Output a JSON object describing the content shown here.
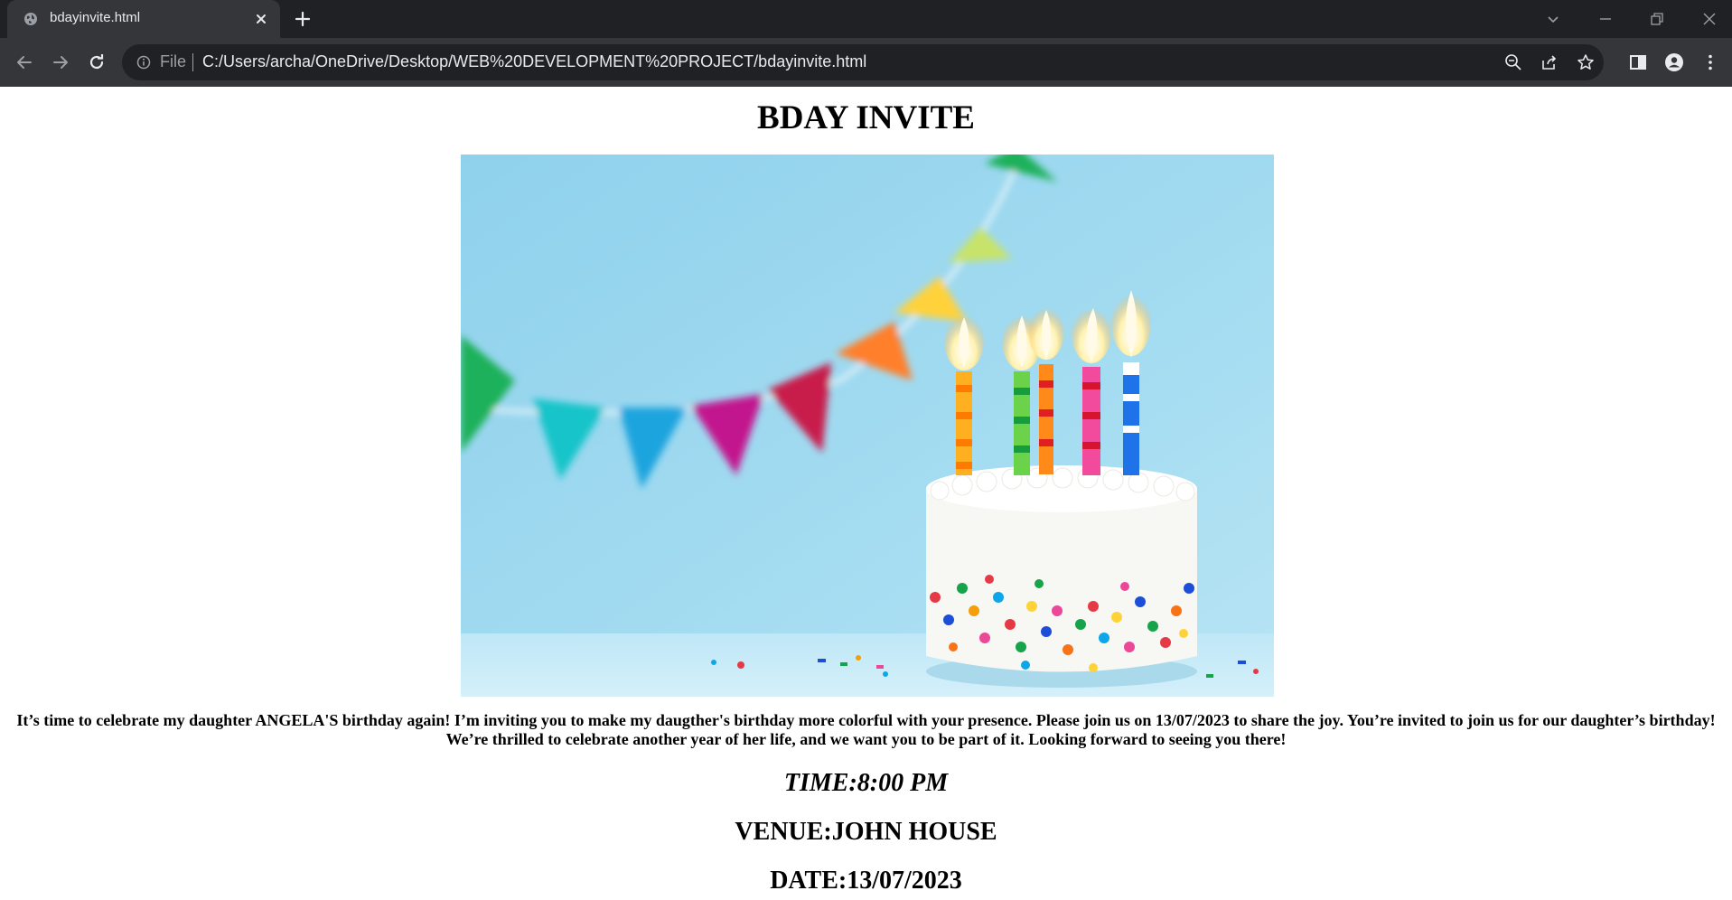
{
  "browser": {
    "tab_title": "bdayinvite.html",
    "file_label": "File",
    "url": "C:/Users/archa/OneDrive/Desktop/WEB%20DEVELOPMENT%20PROJECT/bdayinvite.html",
    "theme": {
      "chrome_dark": "#202124",
      "chrome_mid": "#35363a",
      "text": "#e8eaed",
      "muted": "#9aa0a6"
    }
  },
  "page": {
    "title": "BDAY INVITE",
    "image": {
      "icon": "birthday-cake-image",
      "colors": {
        "background": "#9fd8ef",
        "pennant_colors": [
          "#1fb15a",
          "#12c4c9",
          "#1aa4de",
          "#c2188e",
          "#c81c4c",
          "#ff7f2a",
          "#ffd23a",
          "#c7e36a"
        ]
      }
    },
    "invite_text": "It’s time to celebrate my daughter ANGELA'S birthday again! I’m inviting you to make my daugther's birthday more colorful with your presence. Please join us on 13/07/2023 to share the joy. You’re invited to join us for our daughter’s birthday! We’re thrilled to celebrate another year of her life, and we want you to be part of it. Looking forward to seeing you there!",
    "time": "TIME:8:00 PM",
    "venue": "VENUE:JOHN HOUSE",
    "date": "DATE:13/07/2023"
  }
}
